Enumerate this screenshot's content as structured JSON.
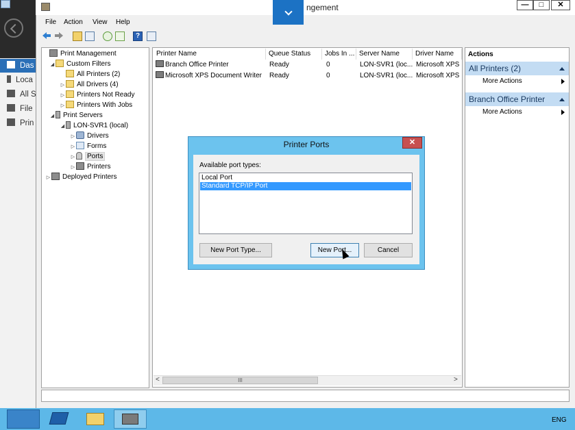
{
  "window": {
    "title": "Print Management",
    "title_visible": "ngement",
    "minimize": "—",
    "maximize": "□",
    "close": "✕"
  },
  "background_app": {
    "items": [
      "Das",
      "Loca",
      "All S",
      "File",
      "Prin"
    ]
  },
  "menu": [
    "File",
    "Action",
    "View",
    "Help"
  ],
  "tree": [
    {
      "label": "Print Management",
      "level": 0,
      "expander": ""
    },
    {
      "label": "Custom Filters",
      "level": 1,
      "expander": "◢"
    },
    {
      "label": "All Printers (2)",
      "level": 2,
      "expander": ""
    },
    {
      "label": "All Drivers (4)",
      "level": 2,
      "expander": "▷"
    },
    {
      "label": "Printers Not Ready",
      "level": 2,
      "expander": "▷"
    },
    {
      "label": "Printers With Jobs",
      "level": 2,
      "expander": "▷"
    },
    {
      "label": "Print Servers",
      "level": 1,
      "expander": "◢"
    },
    {
      "label": "LON-SVR1 (local)",
      "level": 2,
      "expander": "◢"
    },
    {
      "label": "Drivers",
      "level": 3,
      "expander": "▷"
    },
    {
      "label": "Forms",
      "level": 3,
      "expander": "▷"
    },
    {
      "label": "Ports",
      "level": 3,
      "expander": "▷"
    },
    {
      "label": "Printers",
      "level": 3,
      "expander": "▷"
    },
    {
      "label": "Deployed Printers",
      "level": 0,
      "expander": "▷"
    }
  ],
  "list": {
    "columns": [
      "Printer Name",
      "Queue Status",
      "Jobs In ...",
      "Server Name",
      "Driver Name"
    ],
    "rows": [
      [
        "Branch Office Printer",
        "Ready",
        "0",
        "LON-SVR1 (loc...",
        "Microsoft XPS C"
      ],
      [
        "Microsoft XPS Document Writer",
        "Ready",
        "0",
        "LON-SVR1 (loc...",
        "Microsoft XPS D"
      ]
    ],
    "scroll_left": "<",
    "scroll_right": ">",
    "scroll_thumb": "III"
  },
  "actions": {
    "header": "Actions",
    "sections": [
      {
        "title": "All Printers (2)",
        "item": "More Actions"
      },
      {
        "title": "Branch Office Printer",
        "item": "More Actions"
      }
    ]
  },
  "dialog": {
    "title": "Printer Ports",
    "close": "✕",
    "label": "Available port types:",
    "port_types": [
      "Local Port",
      "Standard TCP/IP Port"
    ],
    "selected_index": 1,
    "buttons": {
      "new_port_type": "New Port Type...",
      "new_port": "New Port...",
      "cancel": "Cancel"
    }
  },
  "taskbar": {
    "language": "ENG"
  }
}
